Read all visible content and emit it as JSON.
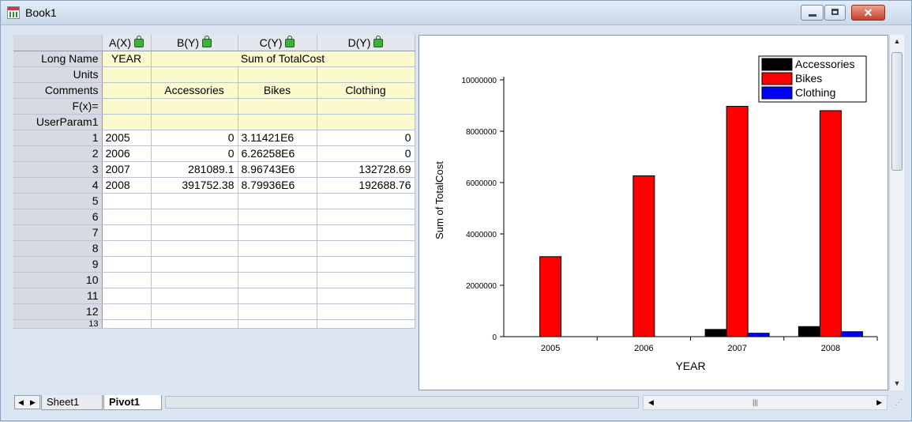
{
  "window": {
    "title": "Book1"
  },
  "columns": [
    {
      "header": "A(X)",
      "long_name": "YEAR",
      "units": "",
      "comments": ""
    },
    {
      "header": "B(Y)",
      "long_name": "Sum of TotalCost",
      "units": "",
      "comments": "Accessories"
    },
    {
      "header": "C(Y)",
      "long_name": "",
      "units": "",
      "comments": "Bikes"
    },
    {
      "header": "D(Y)",
      "long_name": "",
      "units": "",
      "comments": "Clothing"
    }
  ],
  "row_labels": {
    "long_name": "Long Name",
    "units": "Units",
    "comments": "Comments",
    "fx": "F(x)=",
    "userparam": "UserParam1"
  },
  "rows": [
    {
      "num": "1",
      "cells": [
        "2005",
        "0",
        "3.11421E6",
        "0"
      ]
    },
    {
      "num": "2",
      "cells": [
        "2006",
        "0",
        "6.26258E6",
        "0"
      ]
    },
    {
      "num": "3",
      "cells": [
        "2007",
        "281089.1",
        "8.96743E6",
        "132728.69"
      ]
    },
    {
      "num": "4",
      "cells": [
        "2008",
        "391752.38",
        "8.79936E6",
        "192688.76"
      ]
    }
  ],
  "empty_rows": [
    "5",
    "6",
    "7",
    "8",
    "9",
    "10",
    "11",
    "12",
    "13"
  ],
  "sheet_tabs": [
    {
      "label": "Sheet1",
      "active": false
    },
    {
      "label": "Pivot1",
      "active": true
    }
  ],
  "colors": {
    "accessories": "#000000",
    "bikes": "#ff0000",
    "clothing": "#0000ff"
  },
  "chart_data": {
    "type": "bar",
    "categories": [
      "2005",
      "2006",
      "2007",
      "2008"
    ],
    "series": [
      {
        "name": "Accessories",
        "values": [
          0,
          0,
          281089.1,
          391752.38
        ]
      },
      {
        "name": "Bikes",
        "values": [
          3114210,
          6262580,
          8967430,
          8799360
        ]
      },
      {
        "name": "Clothing",
        "values": [
          0,
          0,
          132728.69,
          192688.76
        ]
      }
    ],
    "xlabel": "YEAR",
    "ylabel": "Sum of TotalCost",
    "ylim": [
      0,
      10000000
    ],
    "yticks": [
      "0",
      "2000000",
      "4000000",
      "6000000",
      "8000000",
      "10000000"
    ],
    "legend": "top-right",
    "grid": false
  }
}
